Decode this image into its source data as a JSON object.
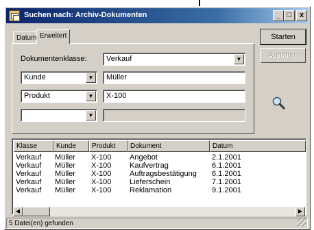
{
  "window": {
    "title": "Suchen nach: Archiv-Dokumenten",
    "controls": {
      "minimize": "_",
      "maximize": "□",
      "close": "x"
    }
  },
  "tabs": [
    {
      "label": "Datum",
      "active": false
    },
    {
      "label": "Erweitert",
      "active": true
    }
  ],
  "form": {
    "doc_class_label": "Dokumentenklasse:",
    "doc_class_value": "Verkauf",
    "criteria": [
      {
        "field": "Kunde",
        "value": "Müller"
      },
      {
        "field": "Produkt",
        "value": "X-100"
      },
      {
        "field": "",
        "value": ""
      }
    ]
  },
  "buttons": {
    "start": "Starten",
    "stop": "Anhalten"
  },
  "icons": {
    "search": "magnifier-icon"
  },
  "results": {
    "columns": [
      "Klasse",
      "Kunde",
      "Produkt",
      "Dokument",
      "Datum"
    ],
    "rows": [
      [
        "Verkauf",
        "Müller",
        "X-100",
        "Angebot",
        "2.1.2001"
      ],
      [
        "Verkauf",
        "Müller",
        "X-100",
        "Kaufvertrag",
        "6.1.2001"
      ],
      [
        "Verkauf",
        "Müller",
        "X-100",
        "Auftragsbestätigung",
        "6.1.2001"
      ],
      [
        "Verkauf",
        "Müller",
        "X-100",
        "Lieferschein",
        "7.1.2001"
      ],
      [
        "Verkauf",
        "Müller",
        "X-100",
        "Reklamation",
        "9.1.2001"
      ]
    ]
  },
  "status": {
    "text": "5 Datei(en) gefunden"
  },
  "colors": {
    "titlebar": "#0a246a",
    "face": "#d4d0c8"
  }
}
